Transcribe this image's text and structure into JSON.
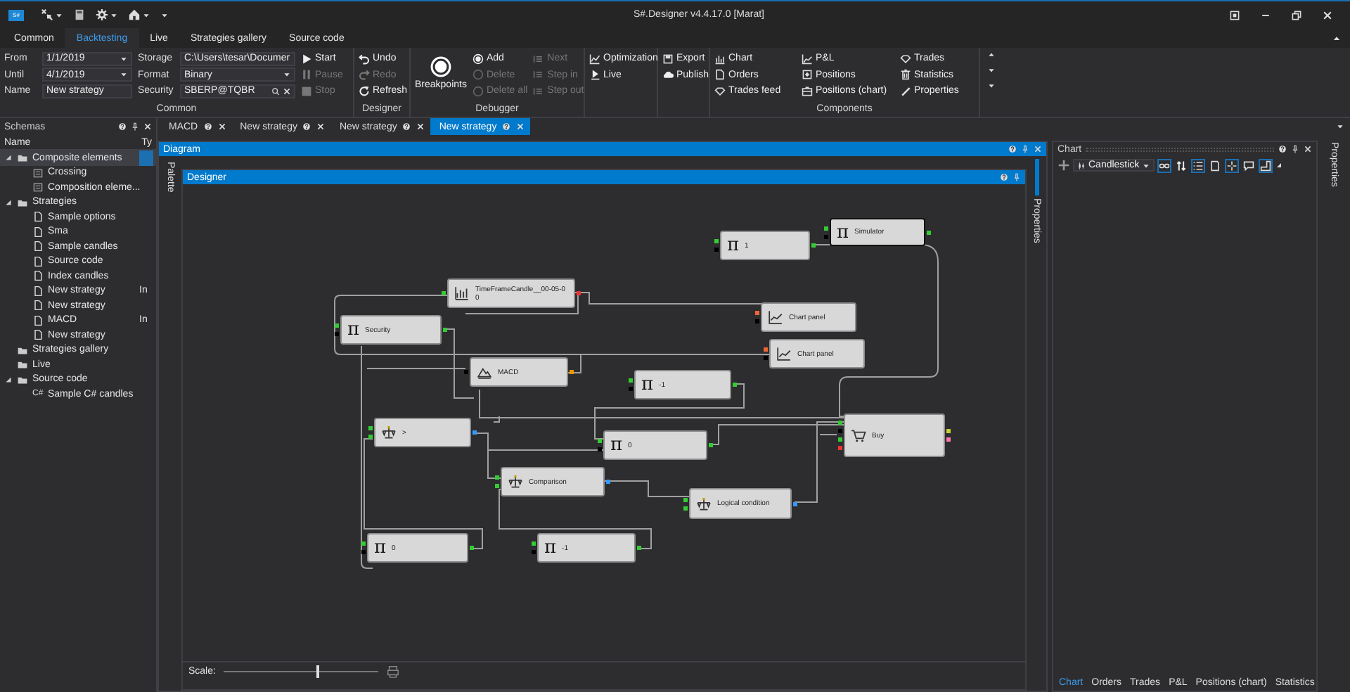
{
  "window": {
    "logo": "S#",
    "title": "S#.Designer v4.4.17.0 [Marat]"
  },
  "ribbon_tabs": [
    {
      "label": "Common",
      "selected": false
    },
    {
      "label": "Backtesting",
      "selected": true
    },
    {
      "label": "Live",
      "selected": false
    },
    {
      "label": "Strategies gallery",
      "selected": false
    },
    {
      "label": "Source code",
      "selected": false
    }
  ],
  "ribbon": {
    "common": {
      "label": "Common",
      "fields": [
        {
          "label": "From",
          "value": "1/1/2019",
          "kind": "dropdown"
        },
        {
          "label": "Until",
          "value": "4/1/2019",
          "kind": "dropdown"
        },
        {
          "label": "Name",
          "value": "New strategy",
          "kind": "text"
        }
      ],
      "fields2": [
        {
          "label": "Storage",
          "value": "C:\\Users\\tesar\\Documer",
          "kind": "dropdown"
        },
        {
          "label": "Format",
          "value": "Binary",
          "kind": "dropdown"
        },
        {
          "label": "Security",
          "value": "SBERP@TQBR",
          "kind": "search"
        }
      ],
      "actions": [
        {
          "label": "Start",
          "kind": "play",
          "disabled": false
        },
        {
          "label": "Pause",
          "kind": "pause",
          "disabled": true
        },
        {
          "label": "Stop",
          "kind": "stop",
          "disabled": true
        }
      ]
    },
    "designer": {
      "label": "Designer",
      "actions": [
        {
          "label": "Undo",
          "kind": "undo",
          "disabled": false
        },
        {
          "label": "Redo",
          "kind": "redo",
          "disabled": true
        },
        {
          "label": "Refresh",
          "kind": "refresh",
          "disabled": false
        }
      ]
    },
    "debugger": {
      "label": "Debugger",
      "breakpoints": "Breakpoints",
      "options": [
        {
          "label": "Add",
          "selected": true,
          "disabled": false
        },
        {
          "label": "Delete",
          "selected": false,
          "disabled": true
        },
        {
          "label": "Delete all",
          "selected": false,
          "disabled": true
        }
      ],
      "steps": [
        {
          "label": "Next",
          "disabled": true
        },
        {
          "label": "Step in",
          "disabled": true
        },
        {
          "label": "Step out",
          "disabled": true
        }
      ]
    },
    "run": [
      {
        "label": "Optimization",
        "kind": "optimization"
      },
      {
        "label": "Live",
        "kind": "live"
      }
    ],
    "share": [
      {
        "label": "Export",
        "kind": "export"
      },
      {
        "label": "Publish",
        "kind": "publish"
      }
    ],
    "components": {
      "label": "Components",
      "items": [
        {
          "label": "Chart",
          "kind": "chart"
        },
        {
          "label": "Orders",
          "kind": "orders"
        },
        {
          "label": "Trades feed",
          "kind": "diamond"
        },
        {
          "label": "P&L",
          "kind": "pnl"
        },
        {
          "label": "Positions",
          "kind": "positions"
        },
        {
          "label": "Positions (chart)",
          "kind": "positions-chart"
        },
        {
          "label": "Trades",
          "kind": "diamond"
        },
        {
          "label": "Statistics",
          "kind": "statistics"
        },
        {
          "label": "Properties",
          "kind": "properties"
        }
      ]
    }
  },
  "schemas": {
    "title": "Schemas",
    "columns": [
      "Name",
      "Ty"
    ],
    "tree": [
      {
        "label": "Composite elements",
        "kind": "folder",
        "selected": true,
        "expanded": true,
        "children": [
          {
            "label": "Crossing",
            "kind": "composite",
            "selected": false
          },
          {
            "label": "Composition eleme...",
            "kind": "composite",
            "selected": false
          }
        ]
      },
      {
        "label": "Strategies",
        "kind": "folder",
        "selected": false,
        "expanded": true,
        "children": [
          {
            "label": "Sample options",
            "kind": "file",
            "selected": false
          },
          {
            "label": "Sma",
            "kind": "file",
            "selected": false
          },
          {
            "label": "Sample candles",
            "kind": "file",
            "selected": false
          },
          {
            "label": "Source code",
            "kind": "file",
            "selected": false
          },
          {
            "label": "Index candles",
            "kind": "file",
            "selected": false
          },
          {
            "label": "New strategy",
            "kind": "file",
            "type": "In",
            "selected": false
          },
          {
            "label": "New strategy",
            "kind": "file",
            "selected": false
          },
          {
            "label": "MACD",
            "kind": "file",
            "type": "In",
            "selected": false
          },
          {
            "label": "New strategy",
            "kind": "file",
            "selected": false
          }
        ]
      },
      {
        "label": "Strategies gallery",
        "kind": "folder",
        "selected": false
      },
      {
        "label": "Live",
        "kind": "folder",
        "selected": false
      },
      {
        "label": "Source code",
        "kind": "folder",
        "selected": false,
        "expanded": true,
        "children": [
          {
            "label": "Sample C# candles",
            "kind": "code",
            "badge": "C#",
            "selected": false
          }
        ]
      }
    ]
  },
  "doc_tabs": [
    {
      "label": "MACD",
      "selected": false
    },
    {
      "label": "New strategy",
      "selected": false
    },
    {
      "label": "New strategy",
      "selected": false
    },
    {
      "label": "New strategy",
      "selected": true
    }
  ],
  "diagram": {
    "title": "Diagram",
    "palette": "Palette",
    "designer_title": "Designer",
    "properties": "Properties",
    "nodes": [
      {
        "label": "1",
        "kind": "constant",
        "symbol": "π",
        "selected": false
      },
      {
        "label": "Simulator",
        "kind": "constant",
        "symbol": "π",
        "selected": true
      },
      {
        "label": "TimeFrameCandle__00-05-0",
        "value": "0",
        "kind": "candles",
        "selected": false
      },
      {
        "label": "Security",
        "kind": "constant",
        "symbol": "π",
        "selected": false
      },
      {
        "label": "Chart panel",
        "kind": "chart",
        "selected": false
      },
      {
        "label": "Chart panel",
        "kind": "chart",
        "selected": false
      },
      {
        "label": "MACD",
        "kind": "indicator",
        "selected": false
      },
      {
        "label": "-1",
        "kind": "constant",
        "symbol": "π",
        "selected": false
      },
      {
        "label": ">",
        "kind": "logic",
        "selected": false
      },
      {
        "label": "0",
        "kind": "constant",
        "symbol": "π",
        "selected": false
      },
      {
        "label": "Buy",
        "kind": "order",
        "selected": false
      },
      {
        "label": "Comparison",
        "kind": "logic",
        "selected": false
      },
      {
        "label": "Logical condition",
        "kind": "logic",
        "selected": false
      },
      {
        "label": "0",
        "kind": "constant",
        "symbol": "π",
        "selected": false
      },
      {
        "label": "-1",
        "kind": "constant",
        "symbol": "π",
        "selected": false
      }
    ],
    "scale": {
      "label": "Scale:",
      "level": 0.6
    }
  },
  "chart_panel": {
    "title": "Chart",
    "chart_type": "Candlestick",
    "toggles": [
      {
        "kind": "link",
        "on": true
      },
      {
        "kind": "sort",
        "on": false
      },
      {
        "kind": "list",
        "on": true
      },
      {
        "kind": "page",
        "on": false
      },
      {
        "kind": "crosshair",
        "on": true
      },
      {
        "kind": "comment",
        "on": false
      },
      {
        "kind": "corner",
        "on": true
      }
    ],
    "tabs": [
      {
        "label": "Chart",
        "selected": true
      },
      {
        "label": "Orders",
        "selected": false
      },
      {
        "label": "Trades",
        "selected": false
      },
      {
        "label": "P&L",
        "selected": false
      },
      {
        "label": "Positions (chart)",
        "selected": false
      },
      {
        "label": "Statistics",
        "selected": false
      }
    ]
  },
  "properties_strip": {
    "label": "Properties"
  }
}
